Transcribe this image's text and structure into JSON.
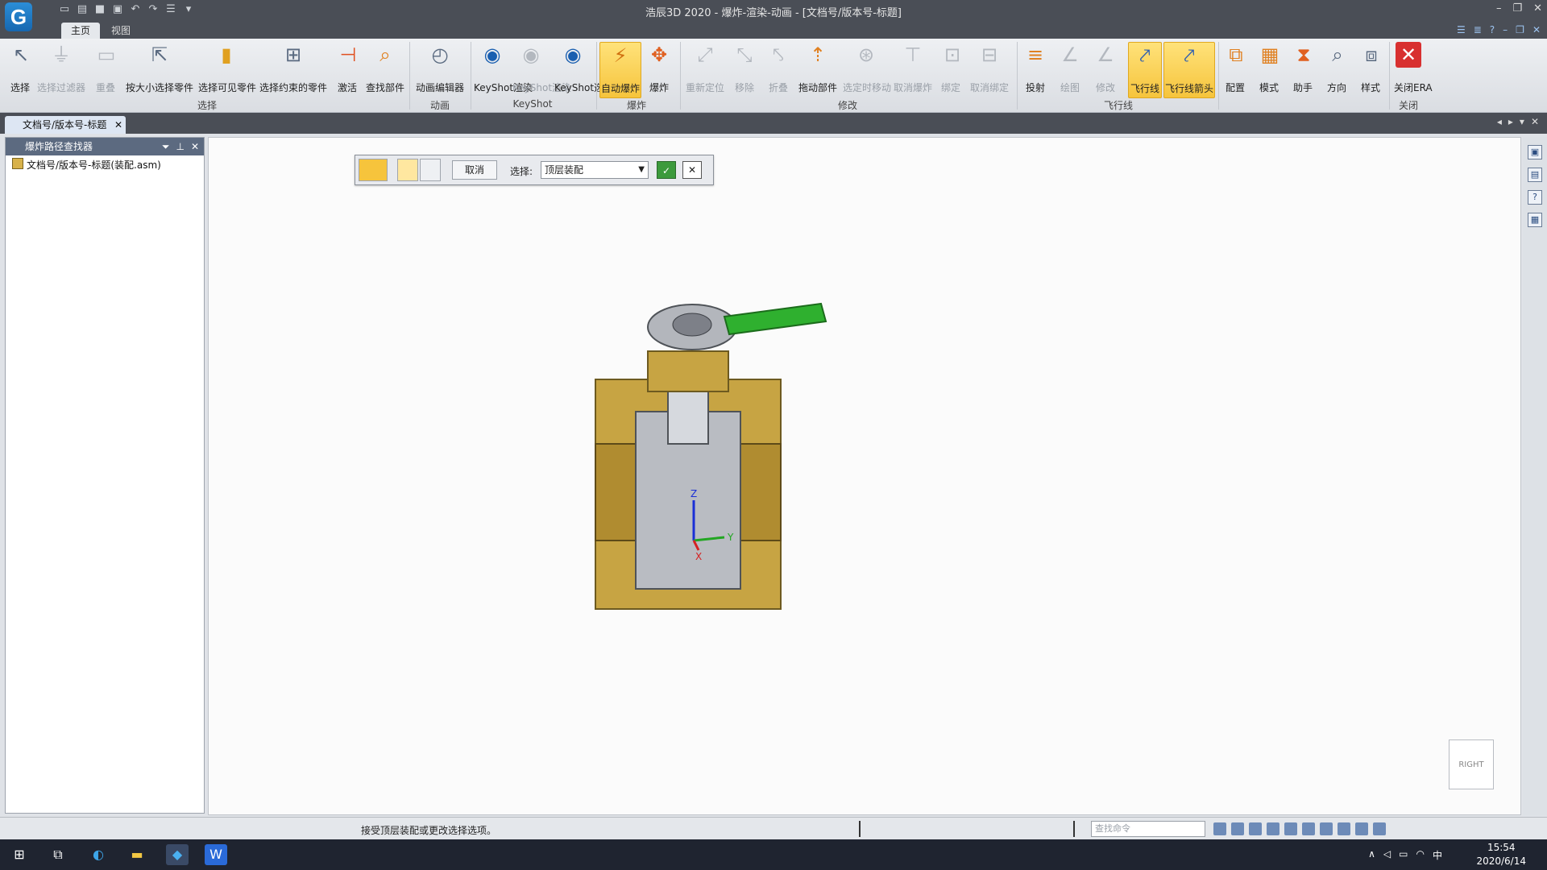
{
  "window": {
    "title": "浩辰3D 2020 - 爆炸-渲染-动画 - [文档号/版本号-标题]",
    "logo": "G"
  },
  "menu": {
    "tabs": [
      "主页",
      "视图"
    ]
  },
  "ribbon": {
    "buttons": [
      "选择",
      "选择过滤器",
      "重叠",
      "按大小选择零件",
      "选择可见零件",
      "选择约束的零件",
      "激活",
      "查找部件",
      "动画编辑器",
      "KeyShot渲染",
      "KeyShot渲染",
      "KeyShot选项",
      "自动爆炸",
      "爆炸",
      "重新定位",
      "移除",
      "折叠",
      "拖动部件",
      "选定时移动",
      "取消爆炸",
      "绑定",
      "取消绑定",
      "投射",
      "绘图",
      "修改",
      "飞行线",
      "飞行线箭头",
      "配置",
      "模式",
      "助手",
      "方向",
      "样式",
      "关闭ERA"
    ],
    "groups": [
      "选择",
      "动画",
      "KeyShot",
      "爆炸",
      "修改",
      "飞行线",
      "关闭"
    ]
  },
  "document_tab": {
    "label": "文档号/版本号-标题"
  },
  "left_panel": {
    "title": "爆炸路径查找器",
    "tree_root": "文档号/版本号-标题(装配.asm)"
  },
  "command_bar": {
    "cancel_label": "取消",
    "select_label": "选择:",
    "select_value": "顶层装配"
  },
  "view": {
    "cube_label": "RIGHT",
    "axes": [
      "Z",
      "Y",
      "X"
    ]
  },
  "status": {
    "message": "接受顶层装配或更改选择选项。",
    "find_placeholder": "查找命令"
  },
  "taskbar": {
    "time": "15:54",
    "date": "2020/6/14",
    "ime": "中"
  }
}
